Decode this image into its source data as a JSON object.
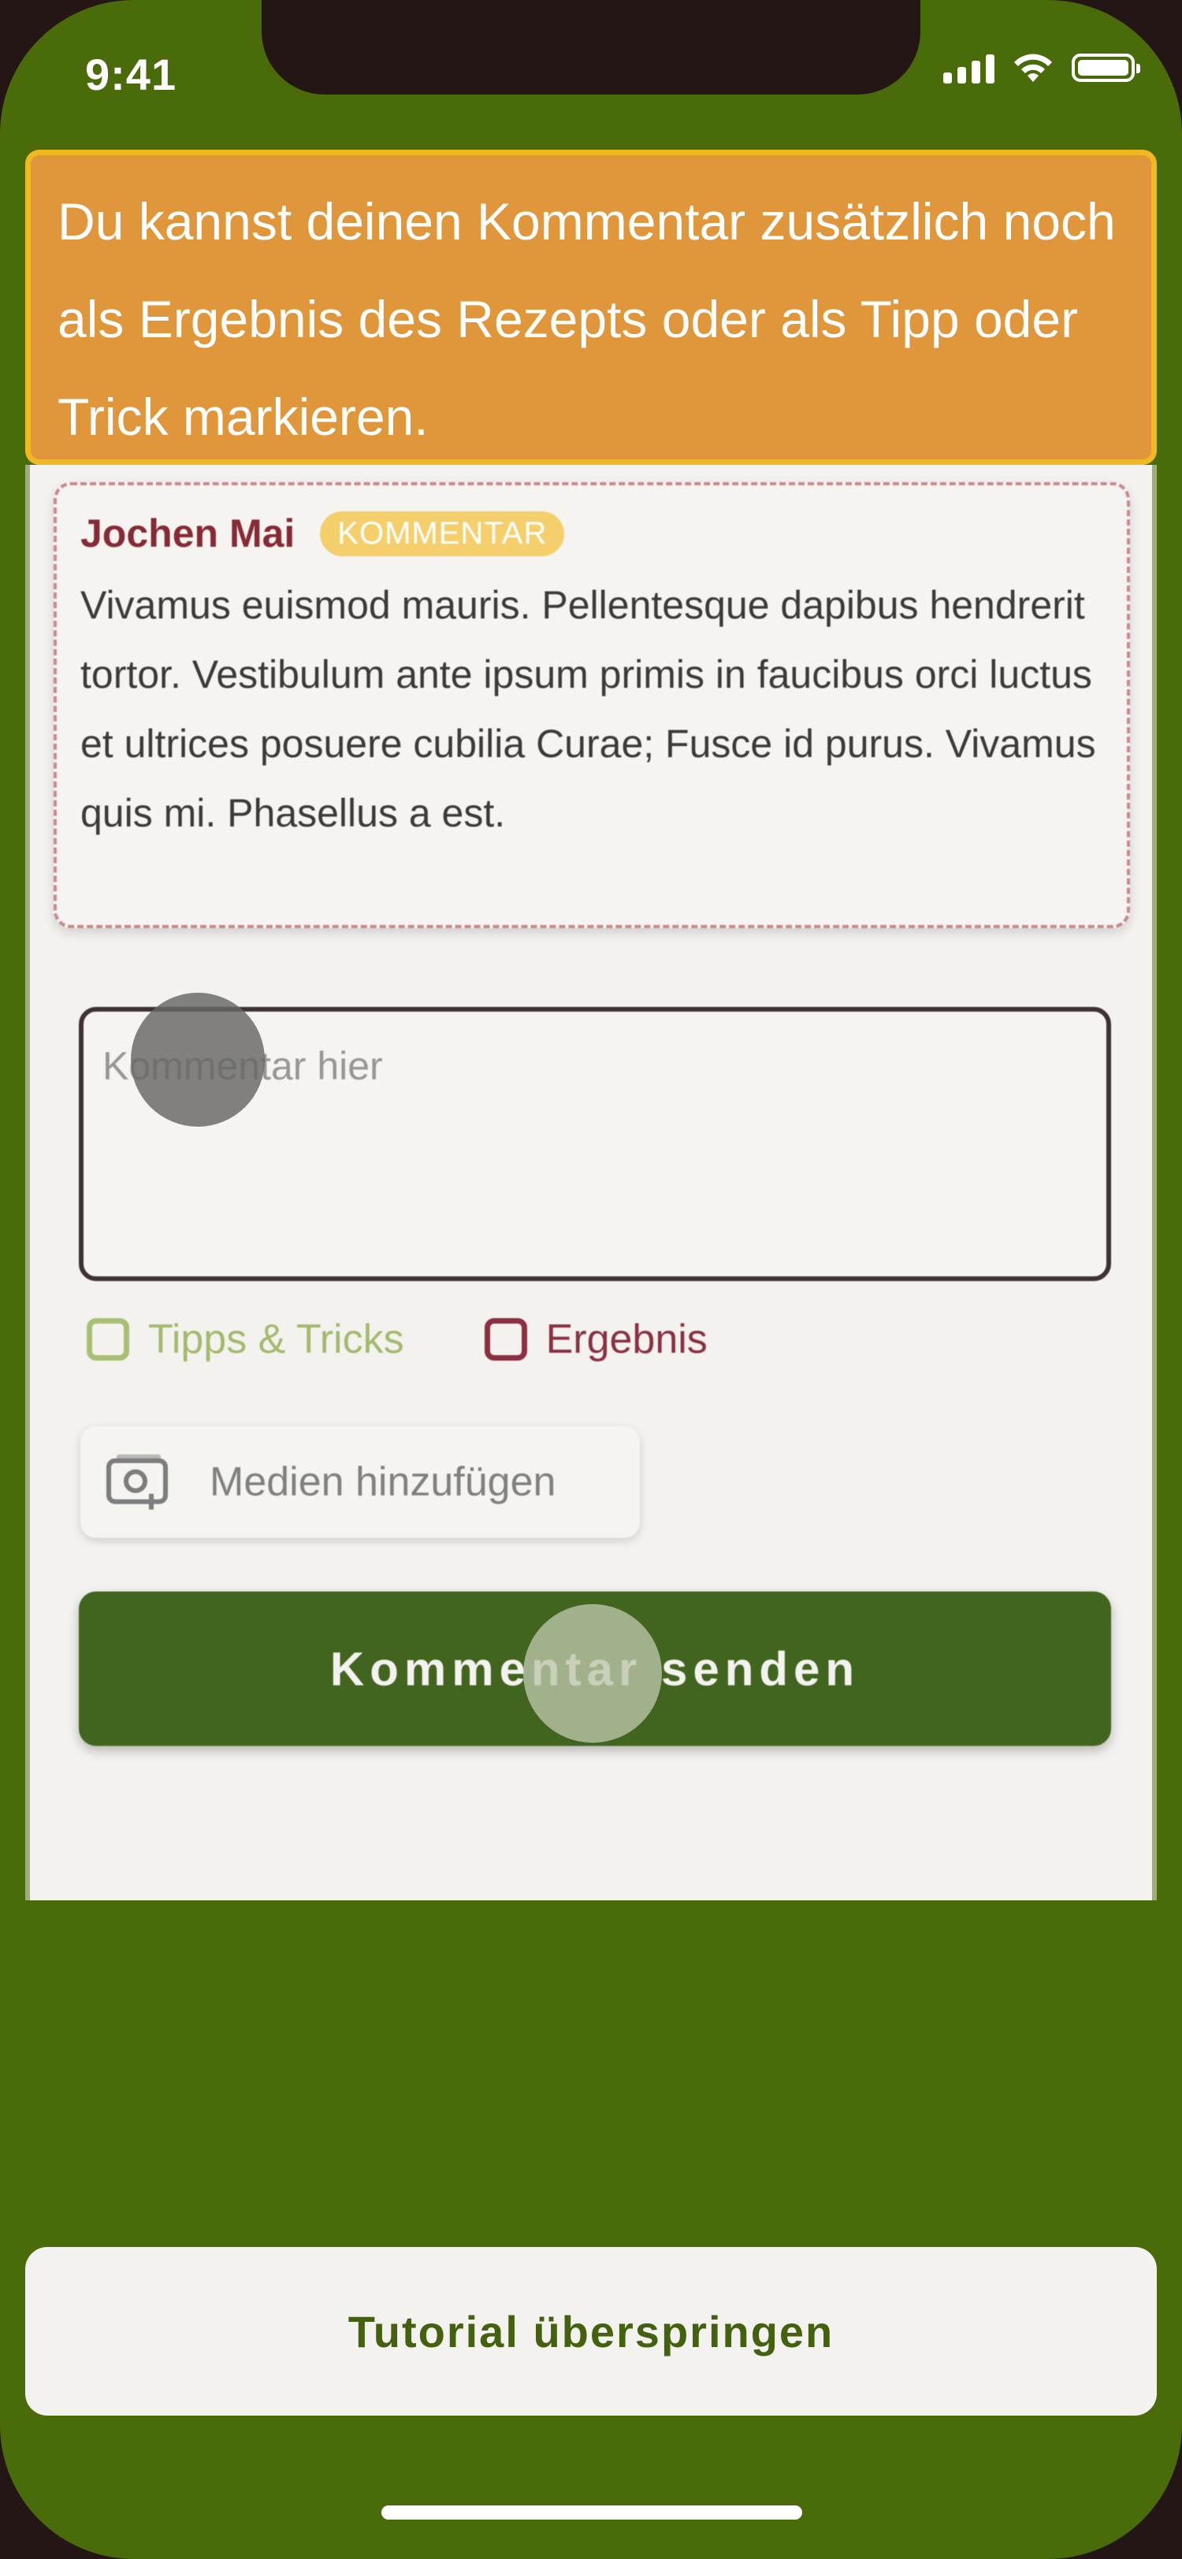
{
  "status_bar": {
    "time": "9:41"
  },
  "tutorial": {
    "message": "Du kannst deinen Kommentar zusätzlich noch als Ergebnis des Rezepts oder als Tipp oder Trick markieren.",
    "skip_label": "Tutorial überspringen"
  },
  "comment": {
    "author": "Jochen Mai",
    "badge": "KOMMENTAR",
    "text": "Vivamus euismod mauris. Pellentesque dapibus hendrerit tortor. Vestibulum ante ipsum primis in faucibus orci luctus et ultrices posuere cubilia Curae; Fusce id purus. Vivamus quis mi. Phasellus a est."
  },
  "form": {
    "input_placeholder": "Kommentar hier",
    "tips_label": "Tipps & Tricks",
    "result_label": "Ergebnis",
    "media_label": "Medien hinzufügen",
    "submit_label": "Kommentar senden"
  },
  "colors": {
    "background_green": "#4a6b09",
    "banner_orange": "#e0963b",
    "banner_border": "#f2b821",
    "submit_green": "#41651e",
    "author_red": "#862a35"
  }
}
